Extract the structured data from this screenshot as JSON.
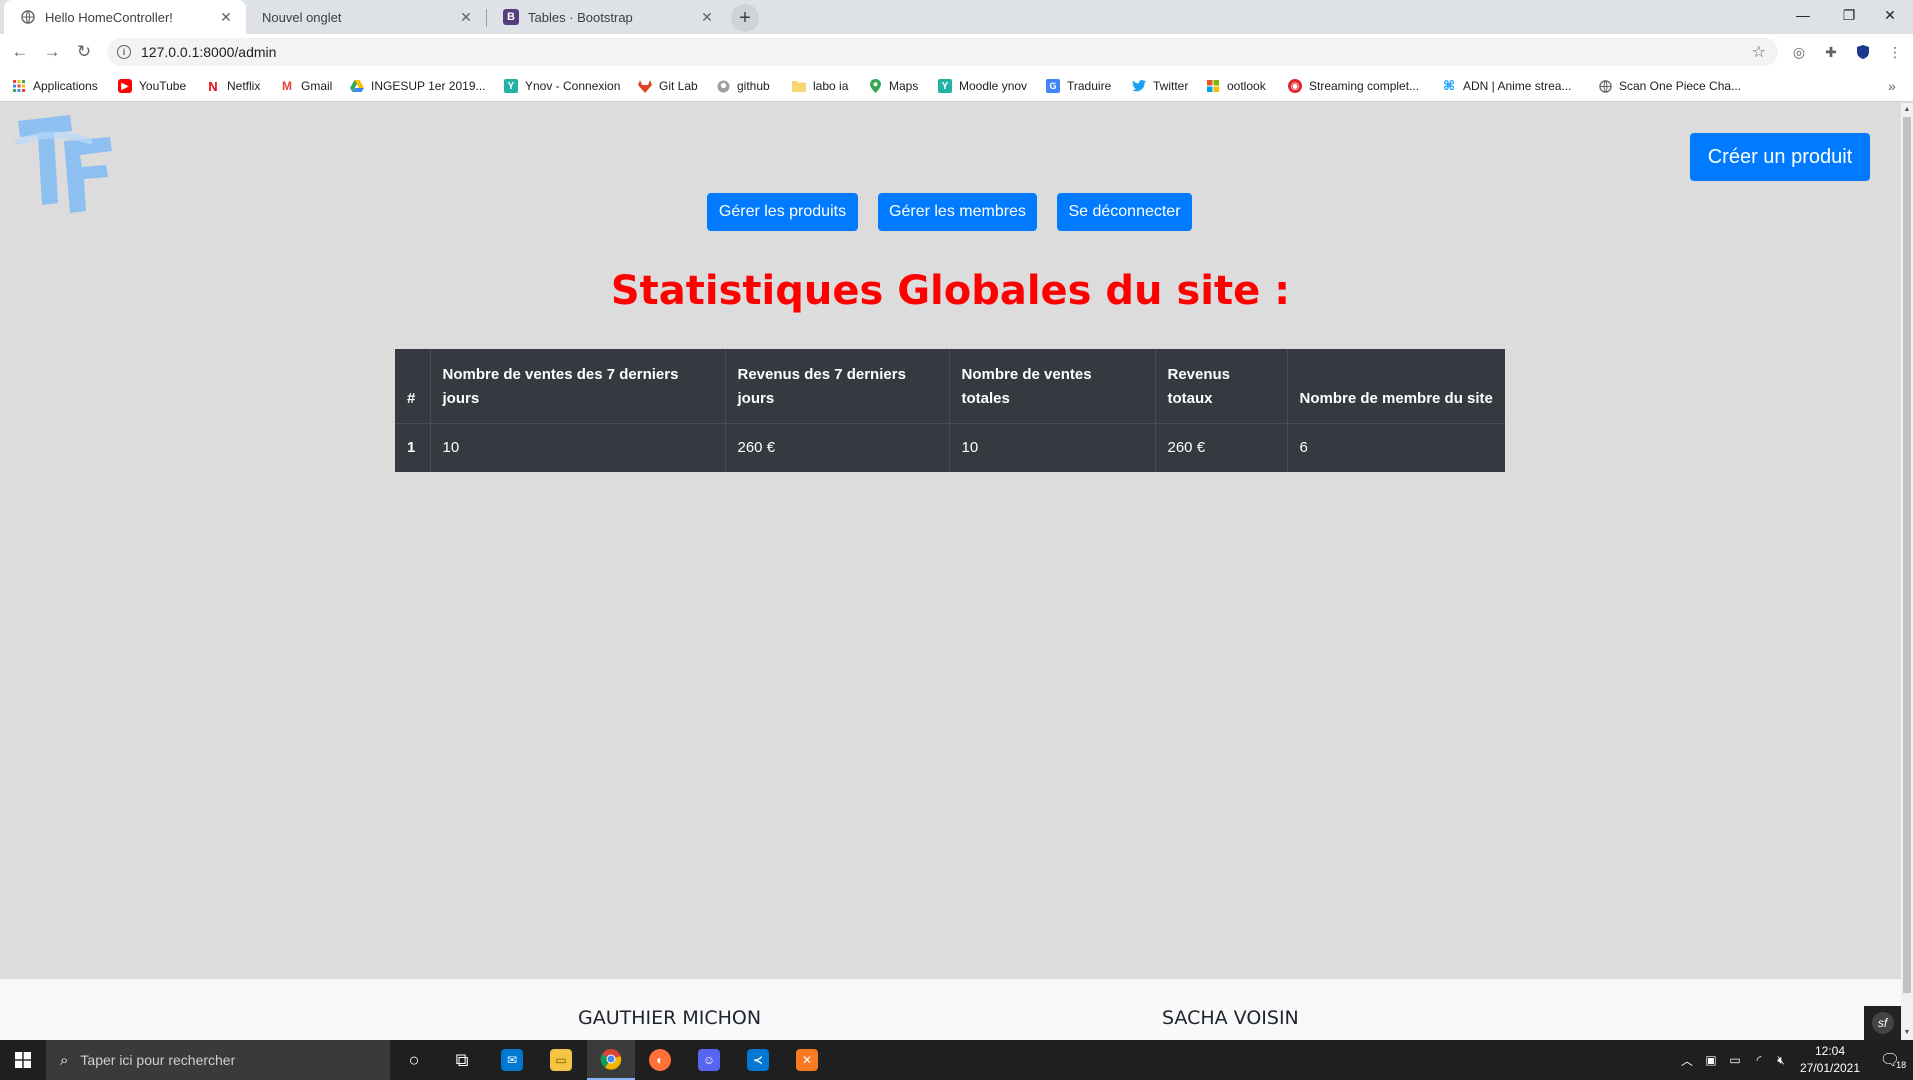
{
  "browser": {
    "tabs": [
      {
        "title": "Hello HomeController!",
        "active": true
      },
      {
        "title": "Nouvel onglet",
        "active": false
      },
      {
        "title": "Tables · Bootstrap",
        "active": false
      }
    ],
    "url": "127.0.0.1:8000/admin",
    "bookmarks": [
      {
        "label": "Applications"
      },
      {
        "label": "YouTube"
      },
      {
        "label": "Netflix"
      },
      {
        "label": "Gmail"
      },
      {
        "label": "INGESUP 1er 2019..."
      },
      {
        "label": "Ynov - Connexion"
      },
      {
        "label": "Git Lab"
      },
      {
        "label": "github"
      },
      {
        "label": "labo ia"
      },
      {
        "label": "Maps"
      },
      {
        "label": "Moodle ynov"
      },
      {
        "label": "Traduire"
      },
      {
        "label": "Twitter"
      },
      {
        "label": "ootlook"
      },
      {
        "label": "Streaming complet..."
      },
      {
        "label": "ADN | Anime strea..."
      },
      {
        "label": "Scan One Piece Cha..."
      }
    ]
  },
  "page": {
    "create_button": "Créer un produit",
    "nav": {
      "manage_products": "Gérer les produits",
      "manage_members": "Gérer les membres",
      "logout": "Se déconnecter"
    },
    "title": "Statistiques Globales du site :",
    "table": {
      "headers": [
        "#",
        "Nombre de ventes des 7 derniers jours",
        "Revenus des 7 derniers jours",
        "Nombre de ventes totales",
        "Revenus totaux",
        "Nombre de membre du site"
      ],
      "rows": [
        [
          "1",
          "10",
          "260 €",
          "10",
          "260 €",
          "6"
        ]
      ]
    },
    "footer": {
      "author1": "GAUTHIER MICHON",
      "author2": "SACHA VOISIN"
    }
  },
  "taskbar": {
    "search_placeholder": "Taper ici pour rechercher",
    "time": "12:04",
    "date": "27/01/2021",
    "notifications": "18"
  },
  "colors": {
    "primary": "#007bff",
    "title_red": "#ff0000",
    "table_dark": "#343a40"
  }
}
